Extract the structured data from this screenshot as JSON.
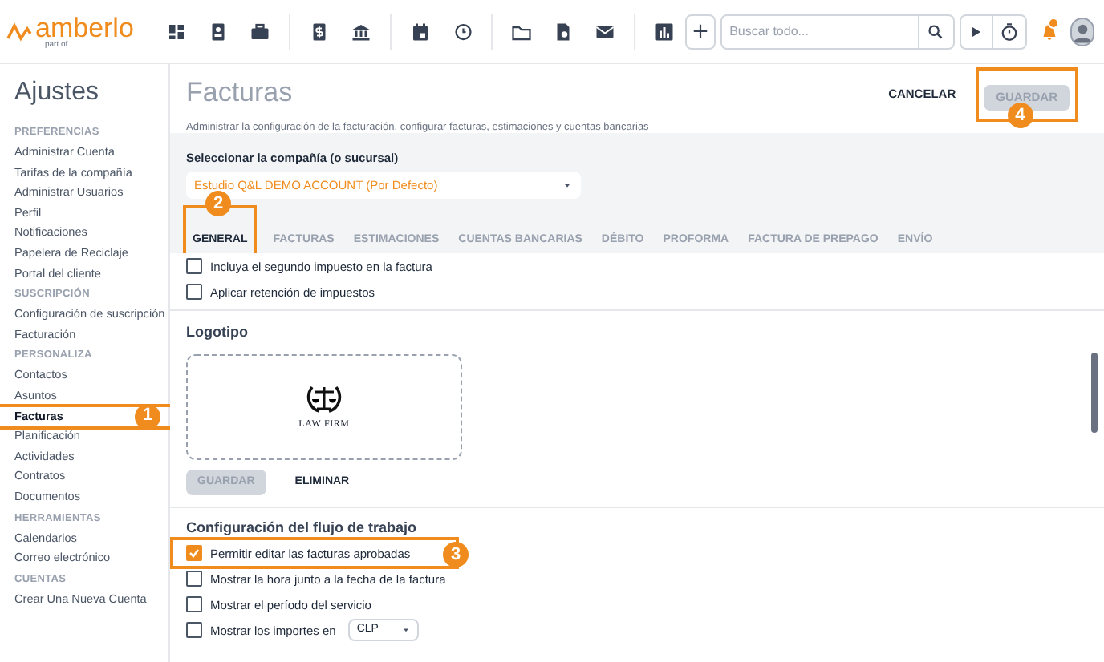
{
  "topbar": {
    "logo": "amberlo",
    "logo_sub": "part of",
    "search": {
      "placeholder": "Buscar todo..."
    }
  },
  "sidebar": {
    "title": "Ajustes",
    "sections": [
      {
        "heading": "PREFERENCIAS",
        "items": [
          {
            "label": "Administrar Cuenta",
            "selected": false
          },
          {
            "label": "Tarifas de la compañía",
            "selected": false
          },
          {
            "label": "Administrar Usuarios",
            "selected": false
          },
          {
            "label": "Perfil",
            "selected": false
          },
          {
            "label": "Notificaciones",
            "selected": false
          },
          {
            "label": "Papelera de Reciclaje",
            "selected": false
          },
          {
            "label": "Portal del cliente",
            "selected": false
          }
        ]
      },
      {
        "heading": "SUSCRIPCIÓN",
        "items": [
          {
            "label": "Configuración de suscripción",
            "selected": false
          },
          {
            "label": "Facturación",
            "selected": false
          }
        ]
      },
      {
        "heading": "PERSONALIZA",
        "items": [
          {
            "label": "Contactos",
            "selected": false
          },
          {
            "label": "Asuntos",
            "selected": false
          },
          {
            "label": "Facturas",
            "selected": true,
            "callout": "1"
          },
          {
            "label": "Planificación",
            "selected": false
          },
          {
            "label": "Actividades",
            "selected": false
          },
          {
            "label": "Contratos",
            "selected": false
          },
          {
            "label": "Documentos",
            "selected": false
          }
        ]
      },
      {
        "heading": "HERRAMIENTAS",
        "items": [
          {
            "label": "Calendarios",
            "selected": false
          },
          {
            "label": "Correo electrónico",
            "selected": false
          }
        ]
      },
      {
        "heading": "CUENTAS",
        "items": [
          {
            "label": "Crear Una Nueva Cuenta",
            "selected": false
          }
        ]
      }
    ]
  },
  "page": {
    "title": "Facturas",
    "subtitle": "Administrar la configuración de la facturación, configurar facturas, estimaciones y cuentas bancarias",
    "cancel": "CANCELAR",
    "save": {
      "label": "GUARDAR",
      "disabled": true,
      "callout": "4"
    }
  },
  "company": {
    "label": "Seleccionar la compañía (o sucursal)",
    "value": "Estudio Q&L DEMO ACCOUNT (Por Defecto)"
  },
  "tabs": [
    {
      "label": "GENERAL",
      "selected": true,
      "callout": "2"
    },
    {
      "label": "FACTURAS",
      "selected": false
    },
    {
      "label": "ESTIMACIONES",
      "selected": false
    },
    {
      "label": "CUENTAS BANCARIAS",
      "selected": false
    },
    {
      "label": "DÉBITO",
      "selected": false
    },
    {
      "label": "PROFORMA",
      "selected": false
    },
    {
      "label": "FACTURA DE PREPAGO",
      "selected": false
    },
    {
      "label": "ENVÍO",
      "selected": false
    }
  ],
  "tax_options": [
    {
      "label": "Incluya el segundo impuesto en la factura",
      "checked": false
    },
    {
      "label": "Aplicar retención de impuestos",
      "checked": false
    }
  ],
  "logo_section": {
    "title": "Logotipo",
    "logo_text": "LAW FIRM",
    "save": "GUARDAR",
    "delete": "ELIMINAR"
  },
  "workflow": {
    "title": "Configuración del flujo de trabajo",
    "options": [
      {
        "label": "Permitir editar las facturas aprobadas",
        "checked": true,
        "callout": "3"
      },
      {
        "label": "Mostrar la hora junto a la fecha de la factura",
        "checked": false
      },
      {
        "label": "Mostrar el período del servicio",
        "checked": false
      },
      {
        "label": "Mostrar los importes en",
        "checked": false,
        "currency": "CLP"
      }
    ]
  }
}
